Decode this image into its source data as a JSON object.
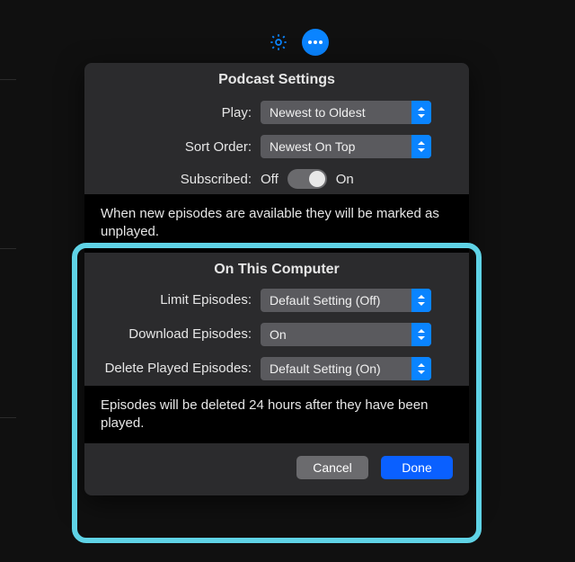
{
  "icons": {
    "gear": "gear-icon",
    "more": "more-icon"
  },
  "panel": {
    "title": "Podcast Settings",
    "play": {
      "label": "Play:",
      "value": "Newest to Oldest"
    },
    "sort": {
      "label": "Sort Order:",
      "value": "Newest On Top"
    },
    "subscribed": {
      "label": "Subscribed:",
      "off": "Off",
      "on": "On",
      "state": "on"
    },
    "info1": "When new episodes are available they will be marked as unplayed.",
    "section2": "On This Computer",
    "limit": {
      "label": "Limit Episodes:",
      "value": "Default Setting (Off)"
    },
    "download": {
      "label": "Download Episodes:",
      "value": "On"
    },
    "delete": {
      "label": "Delete Played Episodes:",
      "value": "Default Setting (On)"
    },
    "info2": "Episodes will be deleted 24 hours after they have been played.",
    "cancel": "Cancel",
    "done": "Done"
  }
}
